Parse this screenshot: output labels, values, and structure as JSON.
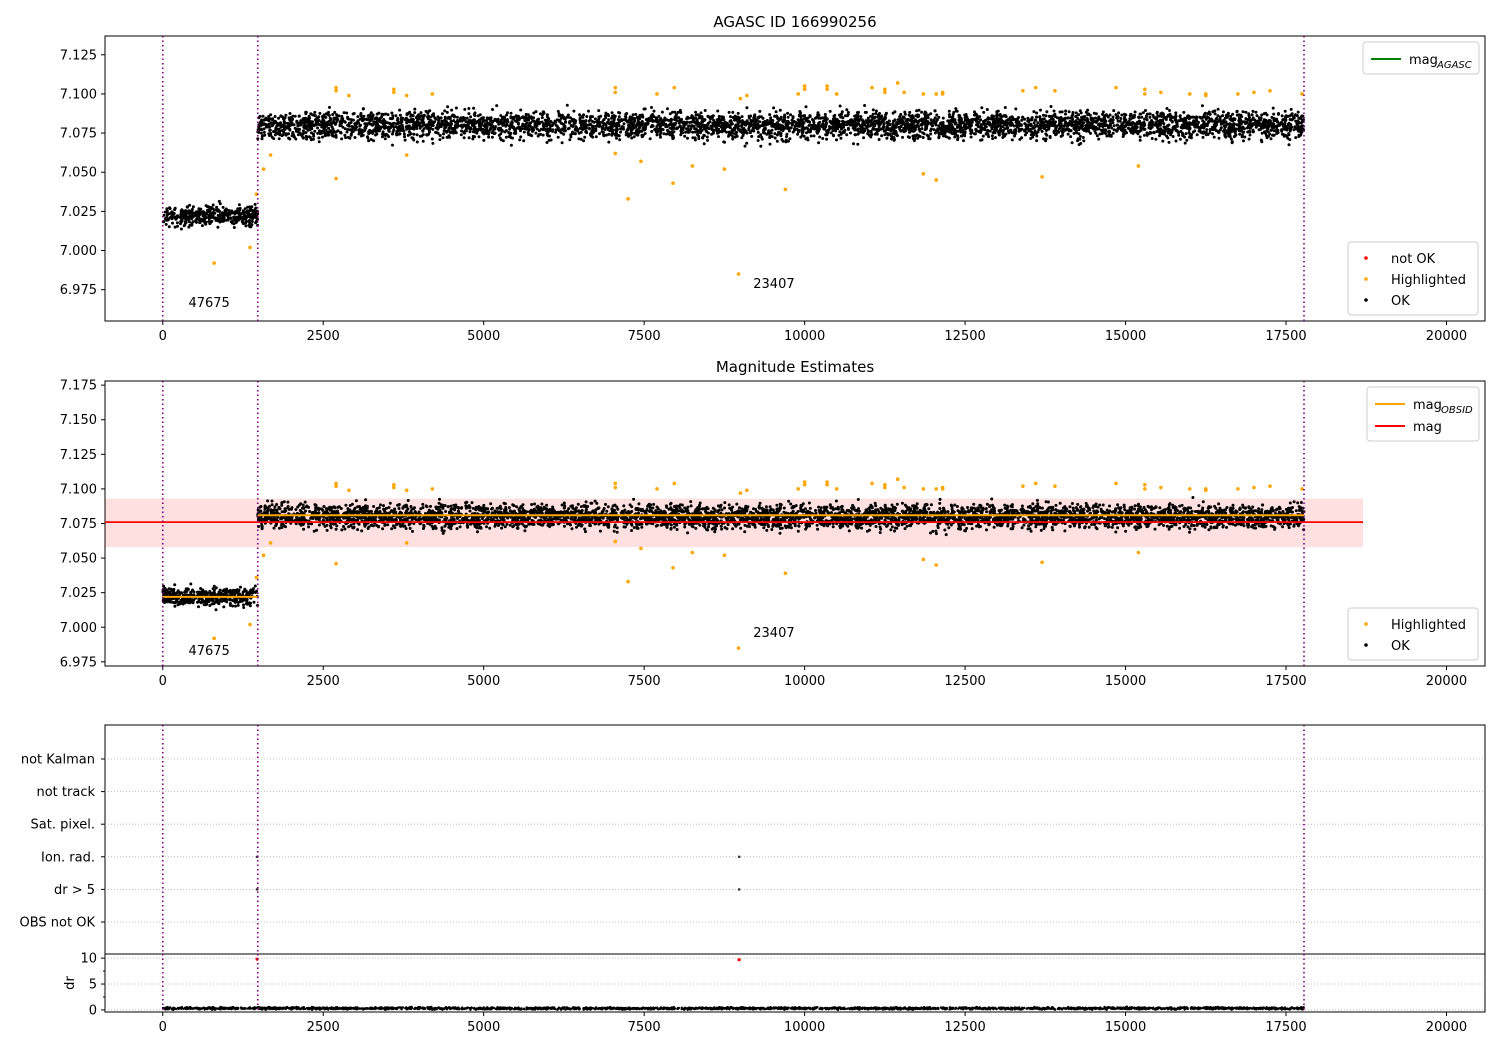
{
  "chart_data": [
    {
      "type": "scatter",
      "title": "AGASC ID 166990256",
      "xlim": [
        -900,
        20600
      ],
      "ylim": [
        6.955,
        7.137
      ],
      "xticks": [
        0,
        2500,
        5000,
        7500,
        10000,
        12500,
        15000,
        17500,
        20000
      ],
      "xtick_labels": [
        "0",
        "2500",
        "5000",
        "7500",
        "10000",
        "12500",
        "15000",
        "17500",
        "20000"
      ],
      "yticks": [
        6.975,
        7.0,
        7.025,
        7.05,
        7.075,
        7.1,
        7.125
      ],
      "ytick_labels": [
        "6.975",
        "7.000",
        "7.025",
        "7.050",
        "7.075",
        "7.100",
        "7.125"
      ],
      "obsid_boundaries": [
        0,
        1480,
        17780
      ],
      "obsid_labels": [
        {
          "text": "47675",
          "x": 400,
          "y": 6.964
        },
        {
          "text": "23407",
          "x": 9200,
          "y": 6.976
        }
      ],
      "series": [
        {
          "name": "OK",
          "color": "#000000",
          "segments": [
            {
              "x_start": 0,
              "x_end": 1480,
              "center": 7.022,
              "spread": 0.008
            },
            {
              "x_start": 1480,
              "x_end": 17780,
              "center": 7.08,
              "spread": 0.011
            }
          ]
        },
        {
          "name": "Highlighted",
          "color": "#ffa500",
          "points": [
            [
              800,
              6.992
            ],
            [
              1360,
              7.002
            ],
            [
              1460,
              7.036
            ],
            [
              1570,
              7.052
            ],
            [
              1680,
              7.061
            ],
            [
              2700,
              7.046
            ],
            [
              2700,
              7.102
            ],
            [
              2700,
              7.104
            ],
            [
              2900,
              7.099
            ],
            [
              3600,
              7.101
            ],
            [
              3600,
              7.103
            ],
            [
              3800,
              7.061
            ],
            [
              3800,
              7.099
            ],
            [
              4200,
              7.1
            ],
            [
              7050,
              7.062
            ],
            [
              7050,
              7.101
            ],
            [
              7050,
              7.104
            ],
            [
              7250,
              7.033
            ],
            [
              7450,
              7.057
            ],
            [
              7700,
              7.1
            ],
            [
              7950,
              7.043
            ],
            [
              7970,
              7.104
            ],
            [
              8250,
              7.054
            ],
            [
              8750,
              7.052
            ],
            [
              8970,
              6.985
            ],
            [
              9000,
              7.097
            ],
            [
              9100,
              7.099
            ],
            [
              9700,
              7.039
            ],
            [
              9900,
              7.1
            ],
            [
              10000,
              7.103
            ],
            [
              10000,
              7.105
            ],
            [
              10350,
              7.103
            ],
            [
              10350,
              7.105
            ],
            [
              10500,
              7.1
            ],
            [
              11050,
              7.104
            ],
            [
              11250,
              7.101
            ],
            [
              11250,
              7.103
            ],
            [
              11450,
              7.107
            ],
            [
              11550,
              7.101
            ],
            [
              11850,
              7.049
            ],
            [
              11850,
              7.1
            ],
            [
              12050,
              7.045
            ],
            [
              12050,
              7.1
            ],
            [
              12150,
              7.1
            ],
            [
              12150,
              7.101
            ],
            [
              13400,
              7.102
            ],
            [
              13600,
              7.104
            ],
            [
              13700,
              7.047
            ],
            [
              13900,
              7.102
            ],
            [
              14850,
              7.104
            ],
            [
              15200,
              7.054
            ],
            [
              15300,
              7.103
            ],
            [
              15300,
              7.1
            ],
            [
              15550,
              7.101
            ],
            [
              16000,
              7.1
            ],
            [
              16250,
              7.1
            ],
            [
              16250,
              7.099
            ],
            [
              16750,
              7.1
            ],
            [
              17000,
              7.101
            ],
            [
              17250,
              7.102
            ],
            [
              17750,
              7.1
            ]
          ]
        },
        {
          "name": "not OK",
          "color": "#ff0000",
          "points": []
        }
      ],
      "lines": [
        {
          "name": "mag$_{AGASC}$",
          "color": "#008000",
          "y": null
        }
      ],
      "legend_lines": [
        {
          "label": "mag",
          "sub": "AGASC",
          "color": "#008000"
        }
      ],
      "legend_markers": [
        {
          "label": "not OK",
          "color": "#ff0000"
        },
        {
          "label": "Highlighted",
          "color": "#ffa500"
        },
        {
          "label": "OK",
          "color": "#000000"
        }
      ]
    },
    {
      "type": "scatter",
      "title": "Magnitude Estimates",
      "xlim": [
        -900,
        20600
      ],
      "ylim": [
        6.972,
        7.178
      ],
      "xticks": [
        0,
        2500,
        5000,
        7500,
        10000,
        12500,
        15000,
        17500,
        20000
      ],
      "xtick_labels": [
        "0",
        "2500",
        "5000",
        "7500",
        "10000",
        "12500",
        "15000",
        "17500",
        "20000"
      ],
      "yticks": [
        6.975,
        7.0,
        7.025,
        7.05,
        7.075,
        7.1,
        7.125,
        7.15,
        7.175
      ],
      "ytick_labels": [
        "6.975",
        "7.000",
        "7.025",
        "7.050",
        "7.075",
        "7.100",
        "7.125",
        "7.150",
        "7.175"
      ],
      "obsid_boundaries": [
        0,
        1480,
        17780
      ],
      "obsid_labels": [
        {
          "text": "47675",
          "x": 400,
          "y": 6.98
        },
        {
          "text": "23407",
          "x": 9200,
          "y": 6.993
        }
      ],
      "mag": {
        "value": 7.076,
        "band": [
          7.058,
          7.093
        ],
        "x_range": [
          -900,
          18700
        ],
        "color": "#ff0000"
      },
      "mag_obsid": [
        {
          "x_start": 0,
          "x_end": 1480,
          "value": 7.022
        },
        {
          "x_start": 1480,
          "x_end": 17780,
          "value": 7.081
        }
      ],
      "series": [
        {
          "name": "OK",
          "color": "#000000",
          "segments": [
            {
              "x_start": 0,
              "x_end": 1480,
              "center": 7.022,
              "spread": 0.008
            },
            {
              "x_start": 1480,
              "x_end": 17780,
              "center": 7.08,
              "spread": 0.011
            }
          ]
        },
        {
          "name": "Highlighted",
          "color": "#ffa500",
          "points": [
            [
              800,
              6.992
            ],
            [
              1360,
              7.002
            ],
            [
              1460,
              7.036
            ],
            [
              1570,
              7.052
            ],
            [
              1680,
              7.061
            ],
            [
              2700,
              7.046
            ],
            [
              2700,
              7.102
            ],
            [
              2700,
              7.104
            ],
            [
              2900,
              7.099
            ],
            [
              3600,
              7.101
            ],
            [
              3600,
              7.103
            ],
            [
              3800,
              7.061
            ],
            [
              3800,
              7.099
            ],
            [
              4200,
              7.1
            ],
            [
              7050,
              7.062
            ],
            [
              7050,
              7.101
            ],
            [
              7050,
              7.104
            ],
            [
              7250,
              7.033
            ],
            [
              7450,
              7.057
            ],
            [
              7700,
              7.1
            ],
            [
              7950,
              7.043
            ],
            [
              7970,
              7.104
            ],
            [
              8250,
              7.054
            ],
            [
              8750,
              7.052
            ],
            [
              8970,
              6.985
            ],
            [
              9000,
              7.097
            ],
            [
              9100,
              7.099
            ],
            [
              9700,
              7.039
            ],
            [
              9900,
              7.1
            ],
            [
              10000,
              7.103
            ],
            [
              10000,
              7.105
            ],
            [
              10350,
              7.103
            ],
            [
              10350,
              7.105
            ],
            [
              10500,
              7.1
            ],
            [
              11050,
              7.104
            ],
            [
              11250,
              7.101
            ],
            [
              11250,
              7.103
            ],
            [
              11450,
              7.107
            ],
            [
              11550,
              7.101
            ],
            [
              11850,
              7.049
            ],
            [
              11850,
              7.1
            ],
            [
              12050,
              7.045
            ],
            [
              12050,
              7.1
            ],
            [
              12150,
              7.1
            ],
            [
              12150,
              7.101
            ],
            [
              13400,
              7.102
            ],
            [
              13600,
              7.104
            ],
            [
              13700,
              7.047
            ],
            [
              13900,
              7.102
            ],
            [
              14850,
              7.104
            ],
            [
              15200,
              7.054
            ],
            [
              15300,
              7.103
            ],
            [
              15300,
              7.1
            ],
            [
              15550,
              7.101
            ],
            [
              16000,
              7.1
            ],
            [
              16250,
              7.1
            ],
            [
              16250,
              7.099
            ],
            [
              16750,
              7.1
            ],
            [
              17000,
              7.101
            ],
            [
              17250,
              7.102
            ],
            [
              17750,
              7.1
            ]
          ]
        }
      ],
      "legend_lines": [
        {
          "label": "mag",
          "sub": "OBSID",
          "color": "#ffa500"
        },
        {
          "label": "mag",
          "sub": "",
          "color": "#ff0000"
        }
      ],
      "legend_markers": [
        {
          "label": "Highlighted",
          "color": "#ffa500"
        },
        {
          "label": "OK",
          "color": "#000000"
        }
      ]
    },
    {
      "type": "scatter",
      "title": "",
      "xlim": [
        -900,
        20600
      ],
      "flag_rows": [
        "not Kalman",
        "not track",
        "Sat. pixel.",
        "Ion. rad.",
        "dr > 5",
        "OBS not OK"
      ],
      "flag_points": [
        {
          "row": "Ion. rad.",
          "x": 1470
        },
        {
          "row": "Ion. rad.",
          "x": 8980
        },
        {
          "row": "dr > 5",
          "x": 1470
        },
        {
          "row": "dr > 5",
          "x": 8980
        }
      ],
      "obsid_boundaries": [
        0,
        1480,
        17780
      ]
    },
    {
      "type": "scatter",
      "xlim": [
        -900,
        20600
      ],
      "ylim": [
        -0.4,
        10.8
      ],
      "ylabel": "dr",
      "xticks": [
        0,
        2500,
        5000,
        7500,
        10000,
        12500,
        15000,
        17500,
        20000
      ],
      "xtick_labels": [
        "0",
        "2500",
        "5000",
        "7500",
        "10000",
        "12500",
        "15000",
        "17500",
        "20000"
      ],
      "yticks": [
        0,
        5,
        10
      ],
      "ytick_labels": [
        "0",
        "5",
        "10"
      ],
      "dr_segment": {
        "x_start": 0,
        "x_end": 17780,
        "center": 0.3,
        "spread": 0.25
      },
      "dr_outliers": [
        [
          1470,
          9.8
        ],
        [
          8980,
          9.7
        ]
      ],
      "obsid_boundaries": [
        0,
        1480,
        17780
      ]
    }
  ]
}
